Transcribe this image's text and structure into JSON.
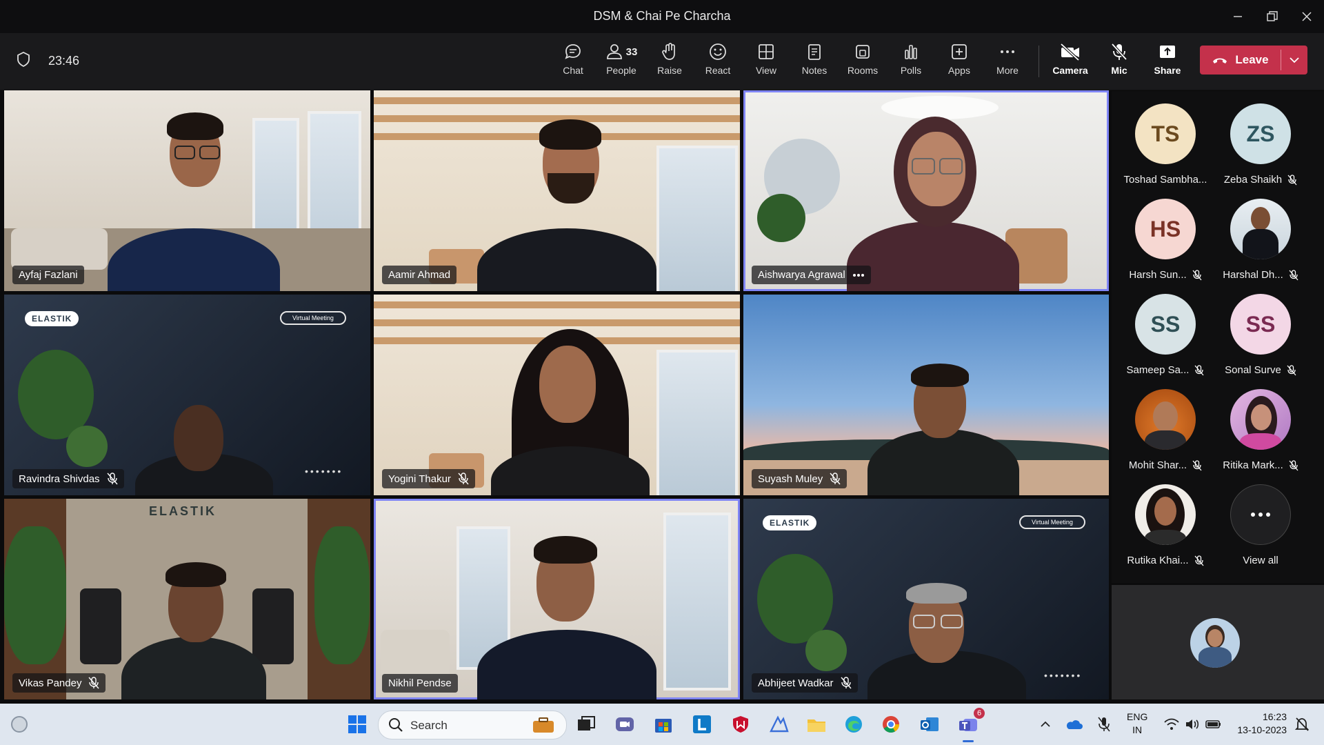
{
  "window": {
    "title": "DSM & Chai Pe Charcha",
    "controls": [
      "minimize",
      "restore",
      "close"
    ]
  },
  "toolbar": {
    "timer": "23:46",
    "people_count": "33",
    "buttons": {
      "chat": "Chat",
      "people": "People",
      "raise": "Raise",
      "react": "React",
      "view": "View",
      "notes": "Notes",
      "rooms": "Rooms",
      "polls": "Polls",
      "apps": "Apps",
      "more": "More",
      "camera": "Camera",
      "mic": "Mic",
      "share": "Share"
    },
    "leave_label": "Leave",
    "leave_color": "#c4314b"
  },
  "video_tiles": [
    {
      "name": "Ayfaj Fazlani",
      "muted": false
    },
    {
      "name": "Aamir Ahmad",
      "muted": false
    },
    {
      "name": "Aishwarya Agrawal",
      "muted": false,
      "speaking": true
    },
    {
      "name": "Ravindra Shivdas",
      "muted": true
    },
    {
      "name": "Yogini Thakur",
      "muted": true
    },
    {
      "name": "Suyash Muley",
      "muted": true
    },
    {
      "name": "Vikas Pandey",
      "muted": true
    },
    {
      "name": "Nikhil Pendse",
      "muted": false,
      "speaking": true
    },
    {
      "name": "Abhijeet Wadkar",
      "muted": true
    }
  ],
  "scene_text": {
    "elastik": "ELASTIK",
    "virtual_meeting": "Virtual Meeting"
  },
  "roster": [
    {
      "initials": "TS",
      "name": "Toshad Sambha...",
      "muted": false,
      "color": "#f3e3c3",
      "text_color": "#6b4a1f"
    },
    {
      "initials": "ZS",
      "name": "Zeba Shaikh",
      "muted": true,
      "color": "#cfe1e6",
      "text_color": "#2e5660"
    },
    {
      "initials": "HS",
      "name": "Harsh Sun...",
      "muted": true,
      "color": "#f6d7d2",
      "text_color": "#7a3226"
    },
    {
      "initials": "",
      "name": "Harshal Dh...",
      "muted": true,
      "photo": true
    },
    {
      "initials": "SS",
      "name": "Sameep Sa...",
      "muted": true,
      "color": "#d8e3e6",
      "text_color": "#2f4f55"
    },
    {
      "initials": "SS",
      "name": "Sonal Surve",
      "muted": true,
      "color": "#f3d7e6",
      "text_color": "#7a2a52"
    },
    {
      "initials": "",
      "name": "Mohit Shar...",
      "muted": true,
      "photo": true
    },
    {
      "initials": "",
      "name": "Ritika Mark...",
      "muted": true,
      "photo": true
    },
    {
      "initials": "",
      "name": "Rutika Khai...",
      "muted": true,
      "photo": true
    },
    {
      "initials": "",
      "name": "View all",
      "muted": false,
      "more": true
    }
  ],
  "taskbar": {
    "search_label": "Search",
    "teams_badge": "6",
    "lang_line1": "ENG",
    "lang_line2": "IN",
    "time": "16:23",
    "date": "13-10-2023"
  }
}
